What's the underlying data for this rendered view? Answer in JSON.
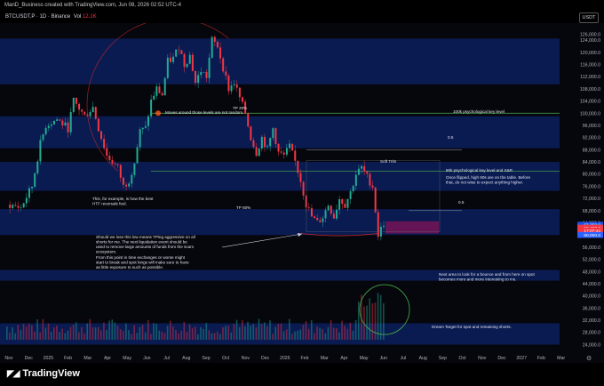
{
  "topbar": {
    "text": "ManD_Business created with TradingView.com, Jun 08, 2026 02:52 UTC-4"
  },
  "header": {
    "symbol": "BTCUSDT.P · 1D · Binance",
    "vol_label": "Vol",
    "vol_value": "12.1K",
    "currency": "USDT"
  },
  "chart_data": {
    "type": "candlestick",
    "y_axis_ticks": [
      "126,000.0",
      "124,000.0",
      "120,000.0",
      "116,000.0",
      "112,000.0",
      "108,000.0",
      "104,000.0",
      "100,000.0",
      "96,000.0",
      "92,000.0",
      "88,000.0",
      "84,000.0",
      "80,000.0",
      "76,000.0",
      "72,000.0",
      "68,000.0",
      "64,000.0",
      "60,000.0",
      "56,000.0",
      "52,000.0",
      "48,000.0",
      "44,000.0",
      "40,000.0",
      "36,000.0",
      "32,000.0",
      "28,000.0",
      "24,000.0"
    ],
    "y_tick_values": [
      126000,
      124000,
      120000,
      116000,
      112000,
      108000,
      104000,
      100000,
      96000,
      92000,
      88000,
      84000,
      80000,
      76000,
      72000,
      68000,
      64000,
      60000,
      56000,
      52000,
      48000,
      44000,
      40000,
      36000,
      32000,
      28000,
      24000
    ],
    "ylim": [
      21500,
      129000
    ],
    "price_labels": [
      "63,350.0",
      "62,400.0",
      "17:07:44",
      "60,000.0"
    ],
    "x_axis_labels": [
      "Nov",
      "Dec",
      "2025",
      "Feb",
      "Mar",
      "Apr",
      "May",
      "Jun",
      "Jul",
      "Aug",
      "Sep",
      "Oct",
      "Nov",
      "Dec",
      "2026",
      "Feb",
      "Mar",
      "Apr",
      "May",
      "Jun",
      "Jul",
      "Aug",
      "Sep",
      "Oct",
      "Nov",
      "Dec",
      "2027",
      "Feb",
      "Mar"
    ],
    "price_path": [
      [
        0,
        70000
      ],
      [
        5,
        69000
      ],
      [
        9,
        76000
      ],
      [
        12,
        90000
      ],
      [
        14,
        96000
      ],
      [
        18,
        98000
      ],
      [
        22,
        95000
      ],
      [
        24,
        104000
      ],
      [
        28,
        99000
      ],
      [
        31,
        102000
      ],
      [
        33,
        95000
      ],
      [
        36,
        86000
      ],
      [
        40,
        82000
      ],
      [
        42,
        76000
      ],
      [
        44,
        78000
      ],
      [
        46,
        84000
      ],
      [
        48,
        94000
      ],
      [
        50,
        95000
      ],
      [
        52,
        104000
      ],
      [
        54,
        108000
      ],
      [
        56,
        106000
      ],
      [
        58,
        117000
      ],
      [
        60,
        118000
      ],
      [
        62,
        122000
      ],
      [
        64,
        116000
      ],
      [
        66,
        119000
      ],
      [
        68,
        110000
      ],
      [
        70,
        114000
      ],
      [
        72,
        112000
      ],
      [
        74,
        124000
      ],
      [
        76,
        122000
      ],
      [
        78,
        115000
      ],
      [
        80,
        108000
      ],
      [
        82,
        110000
      ],
      [
        84,
        105000
      ],
      [
        86,
        100000
      ],
      [
        88,
        92000
      ],
      [
        90,
        87000
      ],
      [
        92,
        92000
      ],
      [
        94,
        88000
      ],
      [
        96,
        95000
      ],
      [
        98,
        87000
      ],
      [
        100,
        86000
      ],
      [
        102,
        89000
      ],
      [
        104,
        84000
      ],
      [
        106,
        78000
      ],
      [
        108,
        70000
      ],
      [
        110,
        66000
      ],
      [
        112,
        64000
      ],
      [
        114,
        66000
      ],
      [
        116,
        70000
      ],
      [
        118,
        66000
      ],
      [
        120,
        72000
      ],
      [
        122,
        70000
      ],
      [
        124,
        74000
      ],
      [
        126,
        80000
      ],
      [
        128,
        82000
      ],
      [
        130,
        79000
      ],
      [
        132,
        76000
      ],
      [
        134,
        60000
      ],
      [
        136,
        64000
      ]
    ],
    "zones": [
      {
        "from": 109500,
        "to": 124500,
        "color": "#0c1f5e"
      },
      {
        "from": 88500,
        "to": 99000,
        "color": "#0c1f5e"
      },
      {
        "from": 74500,
        "to": 84000,
        "color": "#0c1f5e"
      },
      {
        "from": 60000,
        "to": 68500,
        "color": "#0c1f5e"
      },
      {
        "from": 45000,
        "to": 48500,
        "color": "#0c1f5e"
      },
      {
        "from": 24000,
        "to": 31000,
        "color": "#0c1f5e"
      }
    ],
    "key_levels": [
      {
        "value": 100000,
        "color": "#4caf50"
      },
      {
        "value": 81000,
        "color": "#4caf50"
      }
    ],
    "annotations": [
      "TP 20%",
      "Moves around those levels are not random.",
      "100k psychological key level",
      "0.5",
      "Soft Trim",
      "80k psychological key level and S&R",
      "Once flipped, high 90s are on the table. Before that, do not wise to expect anything higher.",
      "0.5",
      "This, for example, is how the best HTF reversals feel.",
      "TP 60%",
      "Should we lose this low means TPing aggressive on all shorts for me. The next liquidation event should be used to remove large amounts of funds from the scam ecosystem.",
      "From this point in time exchanges or worse might start to break and spot longs will make sure to have as little exposure to such as possible.",
      "Next area to look for a bounce and from here on spot becomes more and more interesting to me.",
      "Dream Target for spot and remaining shorts."
    ]
  },
  "footer": {
    "brand": "TradingView"
  }
}
